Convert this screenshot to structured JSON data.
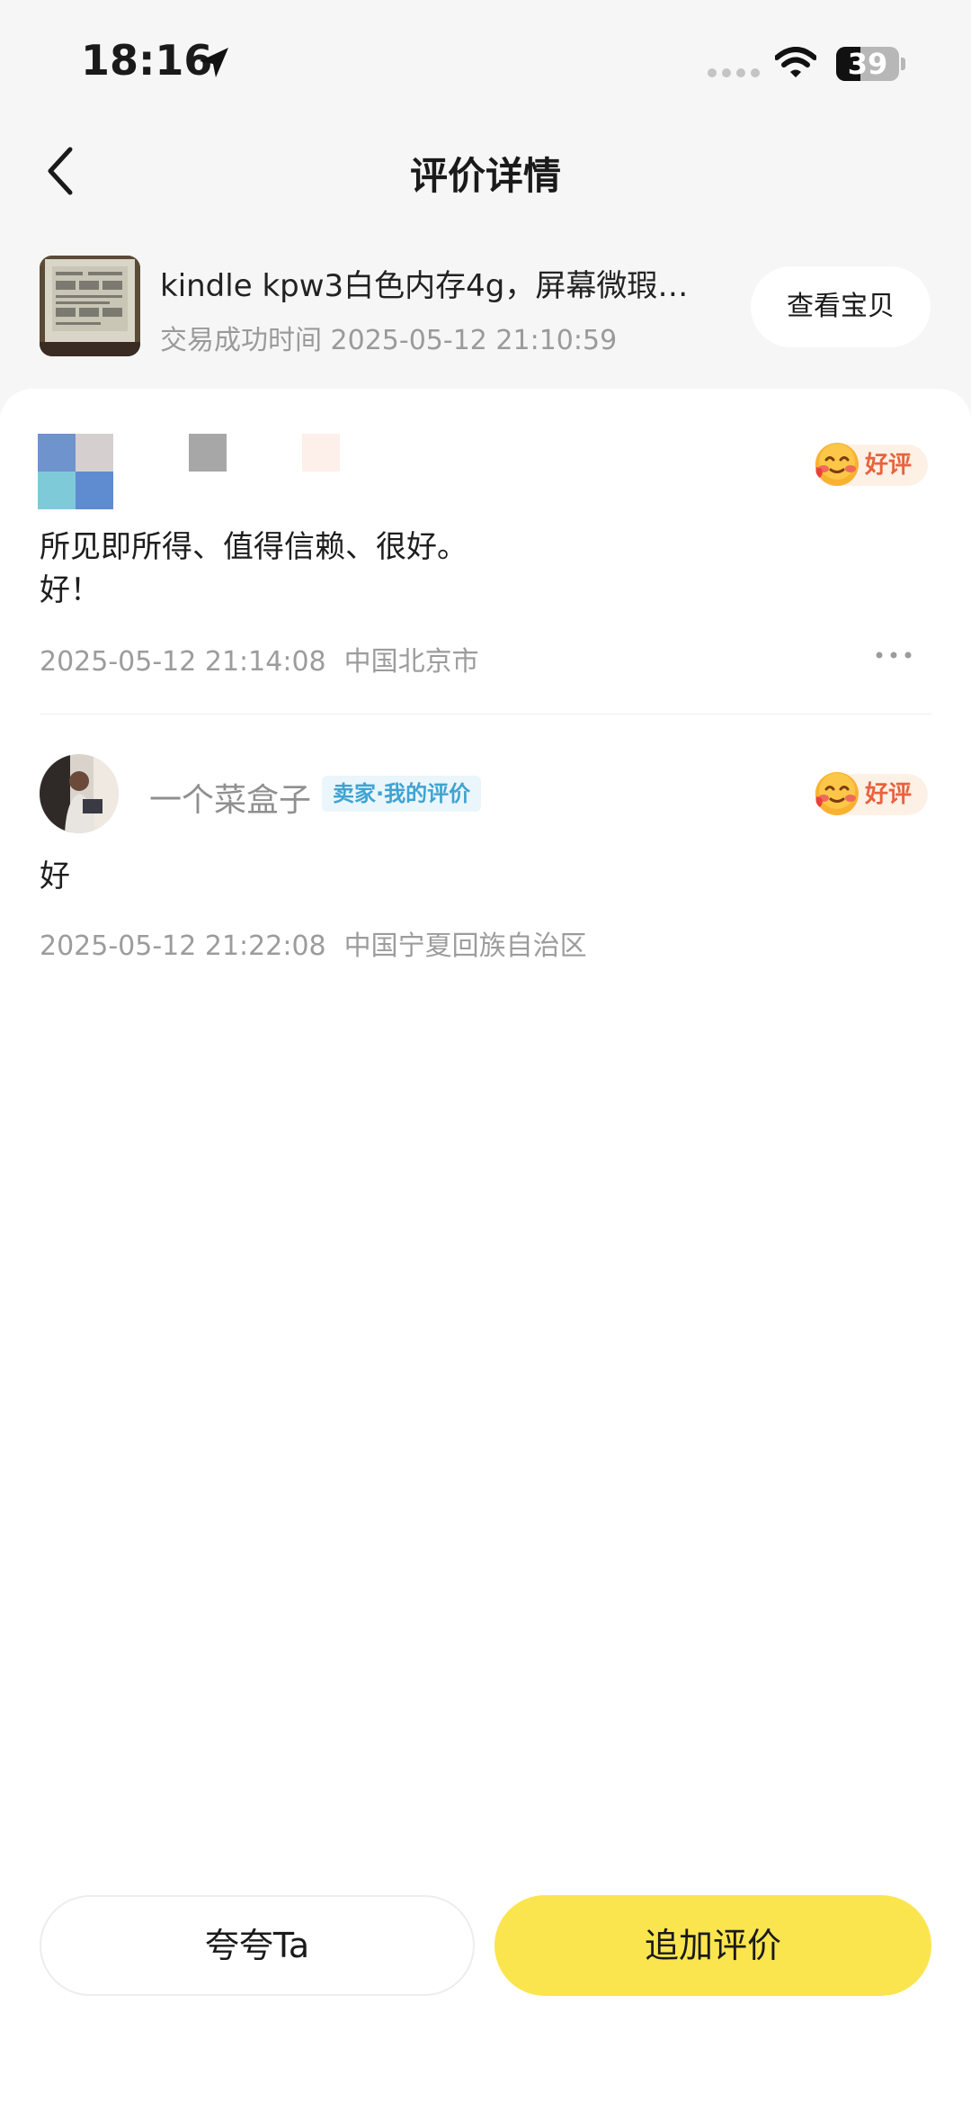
{
  "status_bar": {
    "time": "18:16",
    "battery": "39",
    "battery_level": 0.39
  },
  "nav": {
    "title": "评价详情",
    "back_icon": "chevron-left-icon"
  },
  "product": {
    "title": "kindle kpw3白色内存4g，屏幕微瑕…",
    "time_label": "交易成功时间",
    "time_value": "2025-05-12 21:10:59",
    "view_button": "查看宝贝"
  },
  "reviews": [
    {
      "rating": "好评",
      "text_line1": "所见即所得、值得信赖、很好。",
      "text_line2": "好！",
      "time": "2025-05-12 21:14:08",
      "location": "中国北京市"
    },
    {
      "name": "一个菜盒子",
      "tag": "卖家·我的评价",
      "rating": "好评",
      "text": "好",
      "time": "2025-05-12 21:22:08",
      "location": "中国宁夏回族自治区"
    }
  ],
  "actions": {
    "praise": "夸夸Ta",
    "add_review": "追加评价"
  },
  "colors": {
    "accent_yellow": "#fbe54e",
    "rating_orange": "#e8633e",
    "tag_blue": "#3fa3d2"
  }
}
